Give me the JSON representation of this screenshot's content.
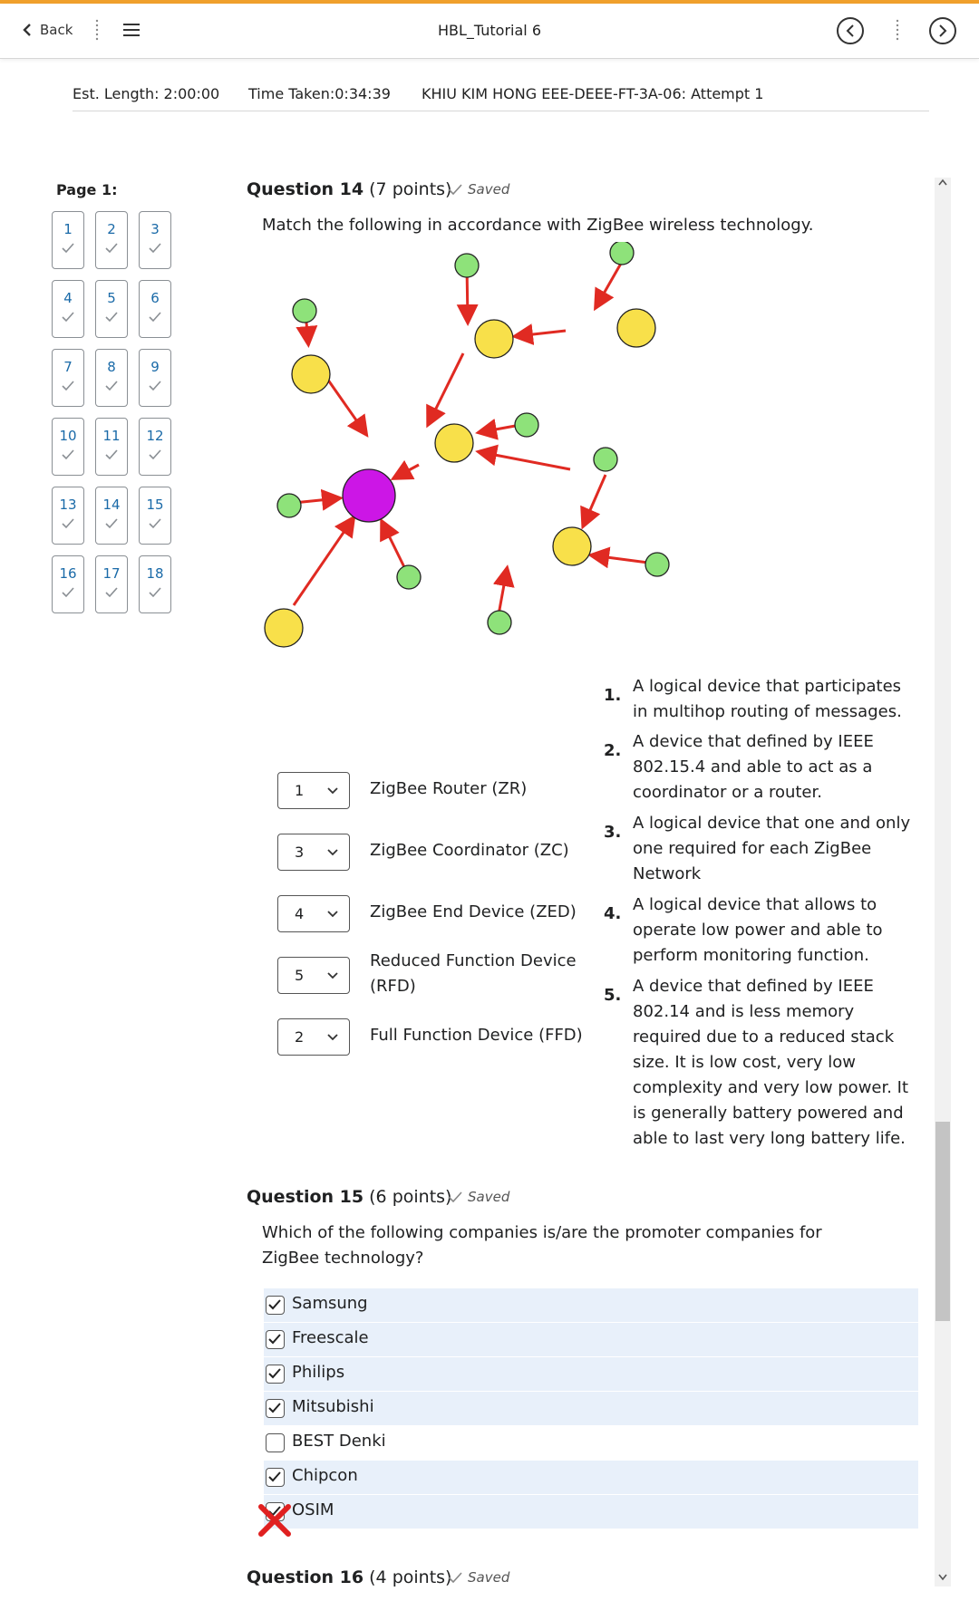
{
  "header": {
    "back_label": "Back",
    "title": "HBL_Tutorial 6",
    "icons": {
      "back": "chevron-left-icon",
      "menu": "hamburger-icon",
      "prev": "circle-chevron-left-icon",
      "next": "circle-chevron-right-icon"
    },
    "accent_color": "#f0a02c"
  },
  "info": {
    "est_length": "Est. Length: 2:00:00",
    "time_taken": "Time Taken:0:34:39",
    "attempt": "KHIU KIM HONG EEE-DEEE-FT-3A-06: Attempt 1"
  },
  "sidebar": {
    "page_label": "Page 1:",
    "questions": [
      "1",
      "2",
      "3",
      "4",
      "5",
      "6",
      "7",
      "8",
      "9",
      "10",
      "11",
      "12",
      "13",
      "14",
      "15",
      "16",
      "17",
      "18"
    ]
  },
  "q14": {
    "title": "Question 14",
    "points": " (7 points)",
    "saved": "Saved",
    "text": "Match the following in accordance with ZigBee wireless technology.",
    "matches": [
      {
        "value": "1",
        "label": "ZigBee Router (ZR)"
      },
      {
        "value": "3",
        "label": "ZigBee Coordinator (ZC)"
      },
      {
        "value": "4",
        "label": "ZigBee End Device (ZED)"
      },
      {
        "value": "5",
        "label": "Reduced Function Device (RFD)"
      },
      {
        "value": "2",
        "label": "Full Function Device (FFD)"
      }
    ],
    "answers": [
      {
        "num": "1.",
        "text": "A logical device that participates in multihop routing of messages."
      },
      {
        "num": "2.",
        "text": "A device that defined by IEEE 802.15.4 and able to act as a coordinator or a router."
      },
      {
        "num": "3.",
        "text": "A logical device that one and only one required for each ZigBee Network"
      },
      {
        "num": "4.",
        "text": "A logical device that allows to operate low power and able to perform monitoring function."
      },
      {
        "num": "5.",
        "text": "A device that defined by IEEE 802.14 and is less memory required due to a reduced stack size. It is low cost, very low complexity and very low power. It is generally battery powered and able to last very long battery life."
      }
    ]
  },
  "q15": {
    "title": "Question 15",
    "points": " (6 points)",
    "saved": "Saved",
    "text": "Which of the following companies is/are the promoter companies for ZigBee technology?",
    "options": [
      {
        "label": "Samsung",
        "checked": true
      },
      {
        "label": "Freescale",
        "checked": true
      },
      {
        "label": "Philips",
        "checked": true
      },
      {
        "label": "Mitsubishi",
        "checked": true
      },
      {
        "label": "BEST Denki",
        "checked": false
      },
      {
        "label": "Chipcon",
        "checked": true
      },
      {
        "label": "OSIM",
        "checked": true
      }
    ]
  },
  "q16": {
    "title": "Question 16",
    "points": " (4 points)",
    "saved": "Saved"
  },
  "colors": {
    "coordinator": "#cc16e6",
    "router": "#f8e04a",
    "end_device": "#8ee27a",
    "arrow": "#e02a22",
    "selected_row": "#e8f0fa"
  }
}
